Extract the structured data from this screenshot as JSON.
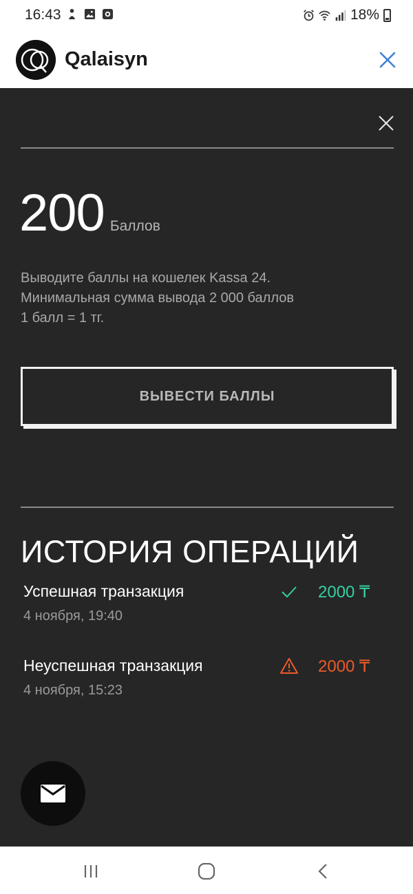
{
  "status_bar": {
    "time": "16:43",
    "left_icons": [
      "puppet-icon",
      "image-icon",
      "record-icon"
    ],
    "right_icons": [
      "alarm-icon",
      "wifi-icon",
      "signal-icon"
    ],
    "battery": "18%"
  },
  "app_header": {
    "brand": "Qalaisyn",
    "close_icon": "close-icon",
    "accent_color": "#3f7fd6"
  },
  "balance": {
    "value": "200",
    "unit": "Баллов"
  },
  "info_lines": [
    "Выводите баллы на кошелек Kassa 24.",
    "Минимальная сумма вывода 2 000 баллов",
    "1 балл = 1 тг."
  ],
  "withdraw_button": "ВЫВЕСТИ БАЛЛЫ",
  "history": {
    "title": "ИСТОРИЯ ОПЕРАЦИЙ",
    "transactions": [
      {
        "title": "Успешная транзакция",
        "date": "4 ноября, 19:40",
        "amount": "2000 ₸",
        "status": "success",
        "icon": "check-icon",
        "color": "#33d1a3"
      },
      {
        "title": "Неуспешная транзакция",
        "date": "4 ноября, 15:23",
        "amount": "2000 ₸",
        "status": "failed",
        "icon": "warning-icon",
        "color": "#ee5a2a"
      }
    ]
  },
  "fab_icon": "mail-icon",
  "nav_bar": [
    "recent-apps-icon",
    "home-icon",
    "back-icon"
  ]
}
